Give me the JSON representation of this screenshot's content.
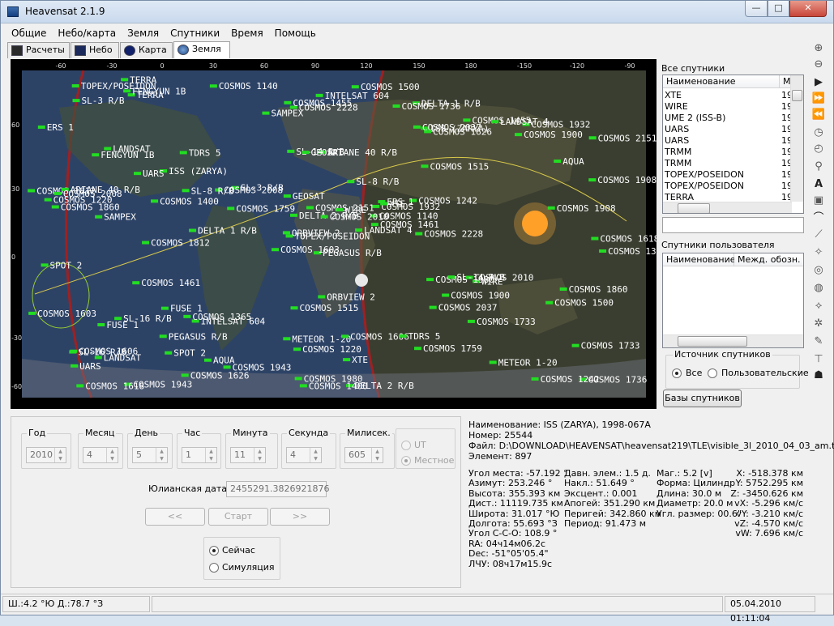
{
  "window": {
    "title": "Heavensat 2.1.9",
    "min": "—",
    "max": "□",
    "close": "✕"
  },
  "menu": [
    "Общие",
    "Небо/карта",
    "Земля",
    "Спутники",
    "Время",
    "Помощь"
  ],
  "tabs": {
    "calc": "Расчеты",
    "sky": "Небо",
    "map": "Карта",
    "earth": "Земля"
  },
  "map": {
    "top_ticks": [
      "-60",
      "-30",
      "0",
      "30",
      "60",
      "90",
      "120",
      "150",
      "180",
      "-150",
      "-120",
      "-90"
    ],
    "left_ticks": [
      "60",
      "30",
      "0",
      "-30",
      "-60"
    ],
    "labels": [
      {
        "t": "PEGASUS R/B"
      },
      {
        "t": "FENGYUN 1B"
      },
      {
        "t": "TOPEX/POSEIDON"
      },
      {
        "t": "COSMOS 1606"
      },
      {
        "t": "COSMOS 1932"
      },
      {
        "t": "INTELSAT 604"
      },
      {
        "t": "DELTA 1 R/B"
      },
      {
        "t": "ARIANE 40 R/B"
      },
      {
        "t": "ISS (ZARYA)"
      },
      {
        "t": "LANDSAT 4"
      },
      {
        "t": "TERRA"
      },
      {
        "t": "COSMOS 1736"
      },
      {
        "t": "SAMPEX"
      },
      {
        "t": "COSMOS 2151"
      },
      {
        "t": "COSMOS 1603"
      },
      {
        "t": "COSMOS 1515"
      },
      {
        "t": "COSMOS 1943"
      },
      {
        "t": "SL-14 R/B"
      },
      {
        "t": "SL-8 R/B"
      },
      {
        "t": "SL-16 R/B"
      },
      {
        "t": "SL-3 R/B"
      },
      {
        "t": "UARS"
      },
      {
        "t": "SPOT 2"
      },
      {
        "t": "GEOSAT"
      },
      {
        "t": "XTE"
      },
      {
        "t": "WIRE"
      },
      {
        "t": "LANDSAT"
      },
      {
        "t": "COSMOS 2228"
      },
      {
        "t": "COSMOS 1860"
      },
      {
        "t": "COSMOS 1980"
      },
      {
        "t": "COSMOS 1908"
      },
      {
        "t": "ORBVIEW 2"
      },
      {
        "t": "METEOR 1-20"
      },
      {
        "t": "DELTA 2 R/B"
      },
      {
        "t": "TDRS 5"
      },
      {
        "t": "COSMOS 1455"
      },
      {
        "t": "COSMOS 1365"
      },
      {
        "t": "COSMOS 1242"
      },
      {
        "t": "COSMOS 1733"
      },
      {
        "t": "COSMOS 2010"
      },
      {
        "t": "COSMOS 1500"
      },
      {
        "t": "COSMOS 2008"
      },
      {
        "t": "COSMOS 1400"
      },
      {
        "t": "COSMOS 2037"
      },
      {
        "t": "COSMOS 1626"
      },
      {
        "t": "COSMOS 1812"
      },
      {
        "t": "COSMOS 1140"
      },
      {
        "t": "COSMOS 1618"
      },
      {
        "t": "COSMOS 1220"
      },
      {
        "t": "COSMOS 1461"
      },
      {
        "t": "FUSE 1"
      },
      {
        "t": "AQUA"
      },
      {
        "t": "ERS 1"
      },
      {
        "t": "COSMOS 1900"
      },
      {
        "t": "COSMOS 1759"
      }
    ]
  },
  "right": {
    "all_title": "Все спутники",
    "all_headers": [
      "Наименование",
      "M"
    ],
    "all_rows": [
      {
        "n": "XTE",
        "m": "19"
      },
      {
        "n": "WIRE",
        "m": "19"
      },
      {
        "n": "UME 2 (ISS-B)",
        "m": "19"
      },
      {
        "n": "UARS",
        "m": "19"
      },
      {
        "n": "UARS",
        "m": "19"
      },
      {
        "n": "TRMM",
        "m": "19"
      },
      {
        "n": "TRMM",
        "m": "19"
      },
      {
        "n": "TOPEX/POSEIDON",
        "m": "19"
      },
      {
        "n": "TOPEX/POSEIDON",
        "m": "19"
      },
      {
        "n": "TERRA",
        "m": "19"
      }
    ],
    "user_title": "Спутники пользователя",
    "user_headers": [
      "Наименование",
      "Межд. обозн."
    ],
    "src_title": "Источник спутников",
    "src_all": "Все",
    "src_user": "Пользовательские",
    "db_button": "Базы спутников"
  },
  "time": {
    "year_label": "Год",
    "year": "2010",
    "month_label": "Месяц",
    "month": "4",
    "day_label": "День",
    "day": "5",
    "hour_label": "Час",
    "hour": "1",
    "minute_label": "Минута",
    "minute": "11",
    "second_label": "Секунда",
    "second": "4",
    "ms_label": "Милисек.",
    "ms": "605",
    "ut": "UT",
    "local": "Местное",
    "julian_label": "Юлианская дата:",
    "julian": "2455291.3826921876",
    "prev": "<<",
    "start": "Старт",
    "next": ">>",
    "now": "Сейчас",
    "sim": "Симуляция"
  },
  "info": {
    "name": "Наименование: ISS (ZARYA),  1998-067A",
    "number": "Номер: 25544",
    "file": "Файл: D:\\DOWNLOAD\\HEAVENSAT\\heavensat219\\TLE\\visible_3l_2010_04_03_am.txt",
    "element": "Элемент: 897",
    "col1": [
      "Угол места: -57.192 °",
      "Азимут: 253.246 °",
      "Высота: 355.393 км",
      "Дист.: 11119.735 км",
      "Широта: 31.017 °Ю",
      "Долгота: 55.693 °З",
      "Угол С-С-О: 108.9 °",
      "RA: 04ч14м06.2с",
      "Dec: -51°05'05.4\"",
      "ЛЧУ: 08ч17м15.9с"
    ],
    "col2": [
      "Давн. элем.: 1.5 д.",
      "Накл.: 51.649 °",
      "Эксцент.: 0.001",
      "Апогей: 351.290 км",
      "Перигей: 342.860 км",
      "Период: 91.473 м"
    ],
    "col3": [
      "Маг.: 5.2 [v]",
      "Форма: Цилиндр",
      "Длина: 30.0 м",
      "Диаметр: 20.0 м",
      "Угл. размер: 00.6\""
    ],
    "col4": [
      "X: -518.378 км",
      "Y: 5752.295 км",
      "Z: -3450.626 км",
      "vX: -5.296 км/с",
      "vY: -3.210 км/с",
      "vZ: -4.570 км/с",
      "vW: 7.696 км/с"
    ]
  },
  "status": {
    "coords": "Ш.:4.2 °Ю Д.:78.7 °З",
    "datetime": "05.04.2010 01:11:04"
  }
}
